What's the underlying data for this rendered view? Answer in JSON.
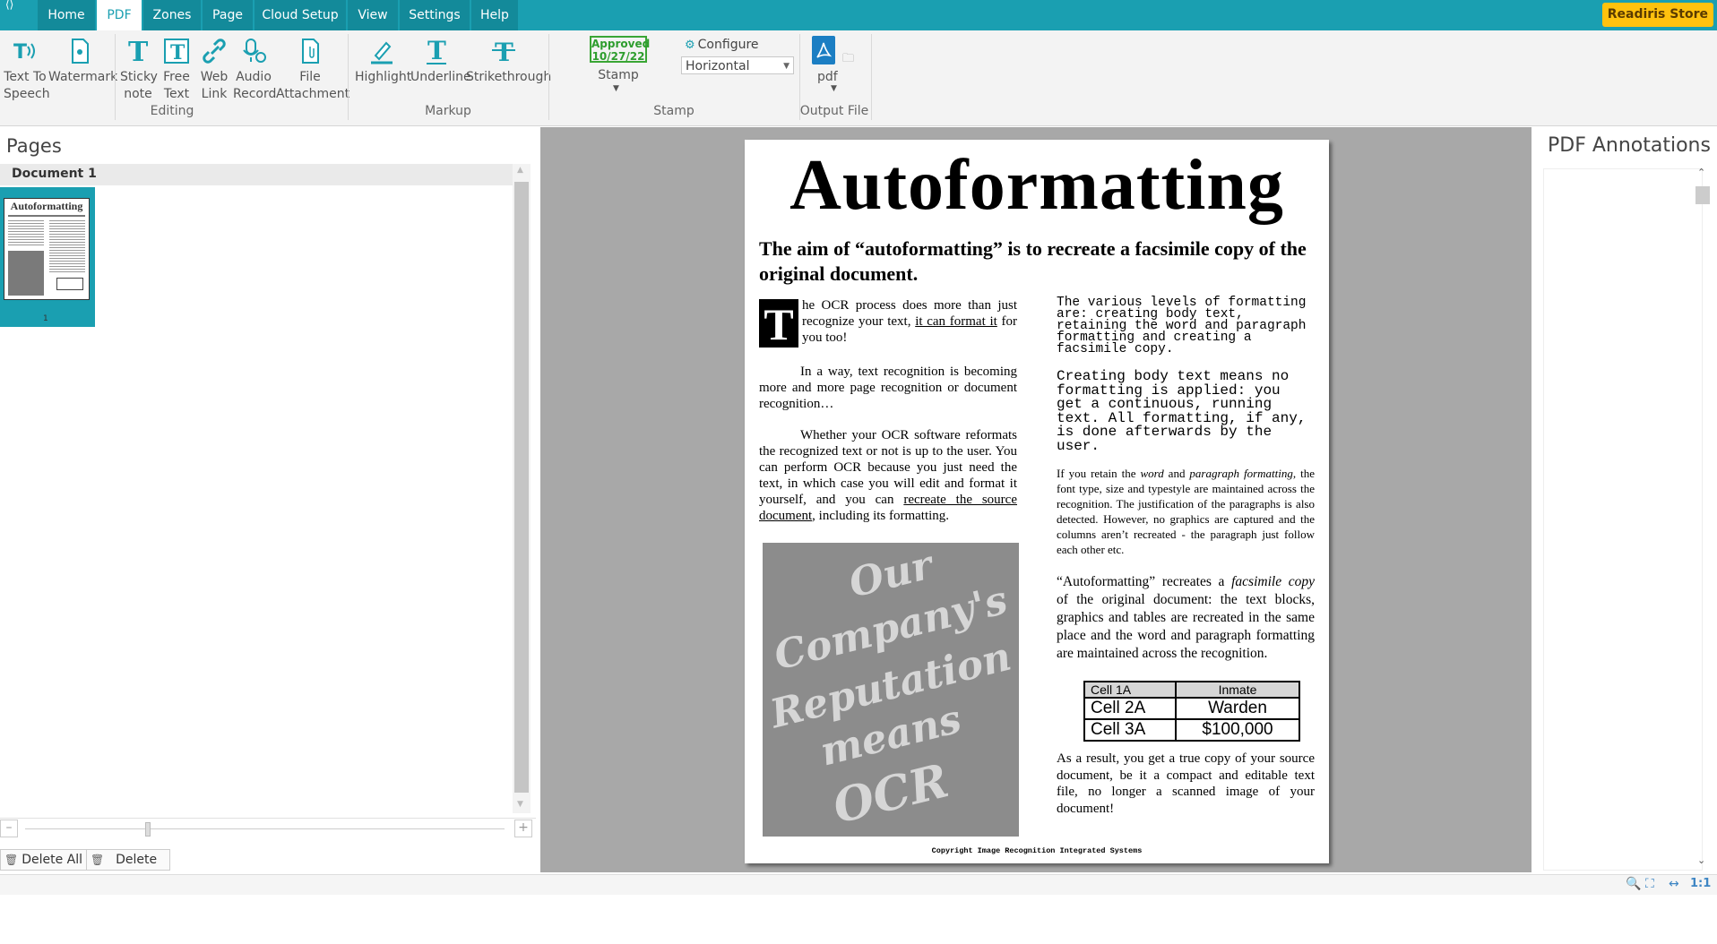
{
  "menu": {
    "tabs": [
      "Home",
      "PDF",
      "Zones",
      "Page",
      "Cloud Setup",
      "View",
      "Settings",
      "Help"
    ],
    "store_button": "Readiris Store"
  },
  "ribbon": {
    "editing": {
      "text_to_speech": [
        "Text To",
        "Speech"
      ],
      "watermark": "Watermark",
      "sticky_note": [
        "Sticky",
        "note"
      ],
      "free_text": [
        "Free",
        "Text"
      ],
      "web_link": [
        "Web",
        "Link"
      ],
      "audio_record": [
        "Audio",
        "Record"
      ],
      "file_attachment": [
        "File",
        "Attachment"
      ],
      "group": "Editing"
    },
    "markup": {
      "highlight": "Highlight",
      "underline": "Underline",
      "strikethrough": "Strikethrough",
      "group": "Markup"
    },
    "stamp": {
      "badge_line1": "Approved",
      "badge_line2": "10/27/22",
      "label": "Stamp",
      "configure": "Configure",
      "orientation": "Horizontal",
      "group": "Stamp"
    },
    "output": {
      "format": "pdf",
      "group": "Output File"
    }
  },
  "pages_panel": {
    "title": "Pages",
    "document_name": "Document 1",
    "thumbnail_number": "1",
    "thumb_title": "Autoformatting",
    "delete_all": "Delete All",
    "delete": "Delete"
  },
  "document": {
    "title": "Autoformatting",
    "subtitle": "The aim of “autoformatting” is to recreate a facsimile copy of the original document.",
    "dropcap": "T",
    "left_p1": "he OCR process does more than just recognize your text, ",
    "left_p1_u": "it can format it",
    "left_p1_end": " for you too!",
    "left_p2": "In a way, text recognition is becoming more and more page recognition or document recognition…",
    "left_p3": "Whether your OCR software reformats the recognized text or not is up to the user. You can perform OCR because you just need the text, in which case you will edit and format it yourself, and you can ",
    "left_p3_u": "recreate the source document",
    "left_p3_end": ", including its formatting.",
    "photo_lines": [
      "Our",
      "Company's",
      "Reputation",
      "means",
      "OCR"
    ],
    "right_p1": "The various levels of formatting are: creating body text, retaining the word and paragraph formatting and creating a facsimile copy.",
    "right_p2": "Creating body text means no formatting is applied: you get a continuous, running text. All formatting, if any, is done afterwards by the user.",
    "right_p3_a": "If you retain the ",
    "right_p3_i1": "word",
    "right_p3_b": " and ",
    "right_p3_i2": "paragraph formatting",
    "right_p3_c": ", the font type, size and typestyle are maintained across the recognition. The justification of the paragraphs is also detected. However, no graphics are captured and the columns aren’t recreated - the paragraph just follow each other etc.",
    "right_p4_a": "“Autoformatting” recreates a ",
    "right_p4_i": "facsimile copy",
    "right_p4_b": " of the original document: the text blocks, graphics and tables are recreated in the same place and the word and paragraph formatting are maintained across the recognition.",
    "table": [
      [
        "Cell 1A",
        "Inmate"
      ],
      [
        "Cell 2A",
        "Warden"
      ],
      [
        "Cell 3A",
        "$100,000"
      ]
    ],
    "right_p5": "As a result, you get a true copy of your source document, be it a compact and editable text file, no longer a scanned image of your document!",
    "copyright": "Copyright Image Recognition Integrated Systems"
  },
  "annotations_panel": {
    "title": "PDF Annotations"
  },
  "status": {
    "zoom": "1:1"
  },
  "colors": {
    "accent": "#1a9fb1",
    "store": "#ffc20e",
    "stamp_green": "#3aa635"
  }
}
